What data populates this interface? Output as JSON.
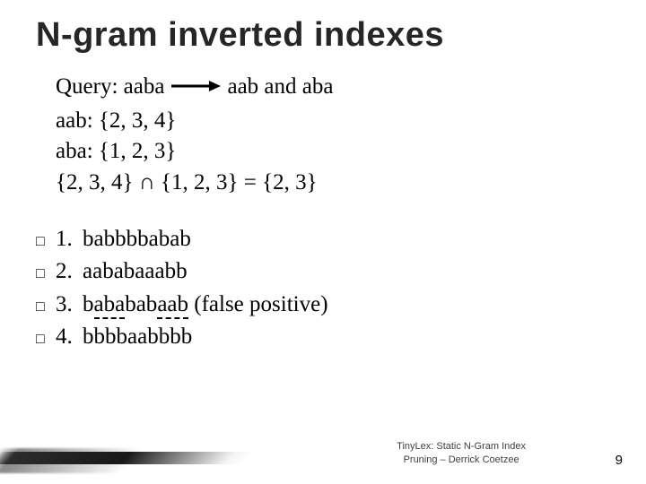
{
  "title": "N-gram inverted indexes",
  "query": {
    "label": "Query:",
    "value": "aaba",
    "derived": "aab and aba"
  },
  "postings": [
    {
      "term": "aab",
      "set": "{2, 3, 4}"
    },
    {
      "term": "aba",
      "set": "{1, 2, 3}"
    }
  ],
  "intersection": "{2, 3, 4} ∩ {1, 2, 3} = {2, 3}",
  "items": [
    {
      "n": "1.",
      "pre": "babbb",
      "match": "bab",
      "mid": "",
      "match2": "ab",
      "post": "",
      "note": ""
    },
    {
      "n": "2.",
      "pre": "",
      "match": "aaba",
      "mid": "",
      "match2": "baaabb",
      "post": "",
      "note": ""
    },
    {
      "n": "3.",
      "pre": "b",
      "match": "aba",
      "mid": "bab",
      "match2": "aab",
      "post": " (false positive)",
      "note": "dash"
    },
    {
      "n": "4.",
      "pre": "bbbbaabbbb",
      "match": "",
      "mid": "",
      "match2": "",
      "post": "",
      "note": ""
    }
  ],
  "bullet": "□",
  "footer": {
    "line1": "TinyLex: Static N-Gram Index",
    "line2": "Pruning – Derrick Coetzee"
  },
  "page": "9"
}
